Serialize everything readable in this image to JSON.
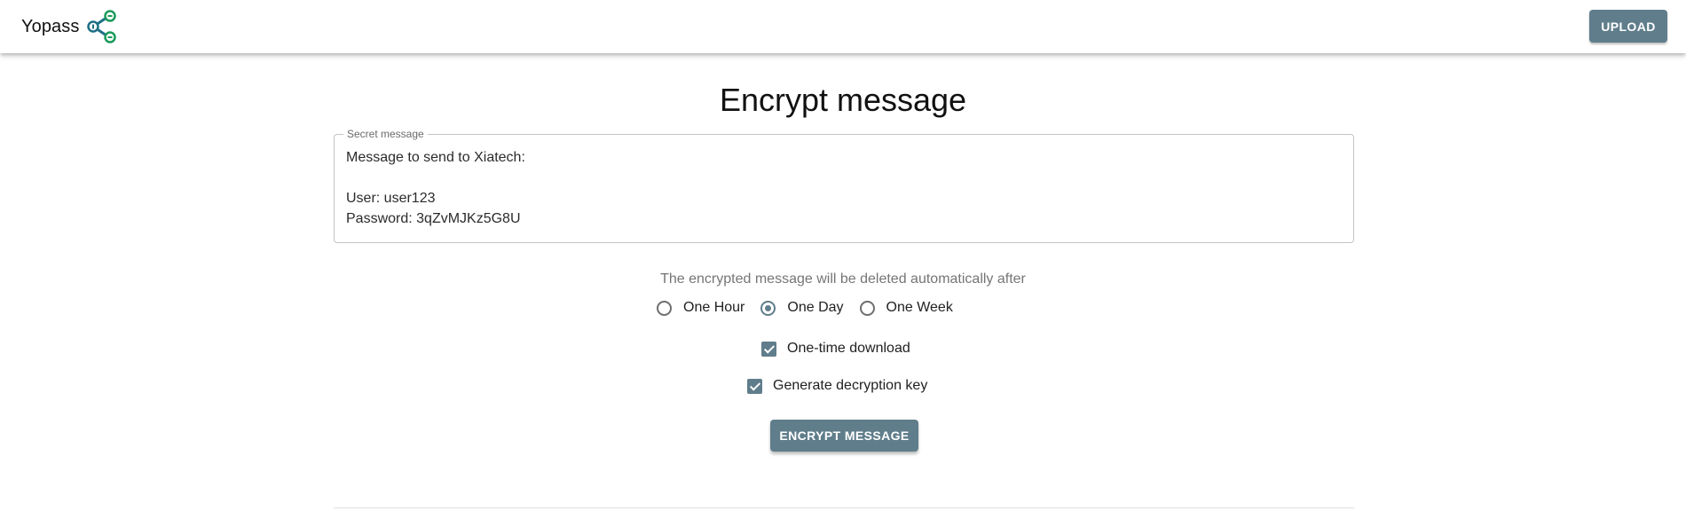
{
  "header": {
    "brand_name": "Yopass",
    "logo_icon": "share-key-icon",
    "upload_label": "UPLOAD"
  },
  "main": {
    "title": "Encrypt message",
    "secret_field": {
      "label": "Secret message",
      "value": "Message to send to Xiatech:\n\nUser: user123\nPassword: 3qZvMJKz5G8U"
    },
    "expiration": {
      "label": "The encrypted message will be deleted automatically after",
      "options": [
        {
          "label": "One Hour",
          "selected": false
        },
        {
          "label": "One Day",
          "selected": true
        },
        {
          "label": "One Week",
          "selected": false
        }
      ]
    },
    "one_time_download": {
      "label": "One-time download",
      "checked": true
    },
    "generate_key": {
      "label": "Generate decryption key",
      "checked": true
    },
    "encrypt_button_label": "ENCRYPT MESSAGE"
  },
  "colors": {
    "accent": "#607d8b",
    "logo_teal": "#1e6f86",
    "logo_green": "#1a9a5a"
  }
}
